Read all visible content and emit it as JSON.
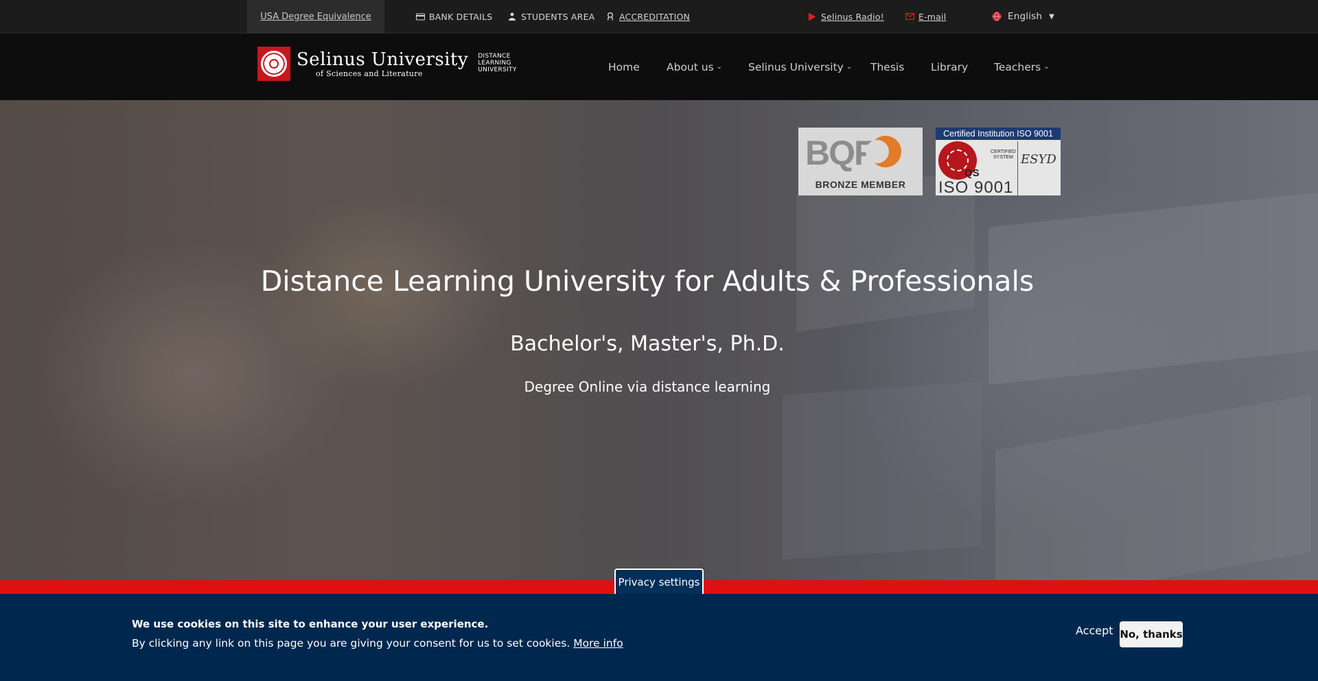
{
  "topbar": {
    "usa_degree": "USA Degree Equivalence",
    "bank_details": "BANK DETAILS",
    "students_area": "STUDENTS AREA",
    "accreditation": "ACCREDITATION",
    "radio": "Selinus Radio!",
    "email": "E-mail",
    "language": "English",
    "icons": {
      "bank": "bank-card-icon",
      "students": "student-icon",
      "accreditation": "award-icon",
      "radio": "play-icon",
      "email": "envelope-icon",
      "language": "globe-icon"
    }
  },
  "header": {
    "logo": {
      "name_line1": "Selinus University",
      "name_line2": "of Sciences and Literature",
      "sub": [
        "DISTANCE",
        "LEARNING",
        "UNIVERSITY"
      ]
    },
    "nav": [
      {
        "label": "Home"
      },
      {
        "label": "About us"
      },
      {
        "label": "Selinus University"
      },
      {
        "label": "Thesis"
      },
      {
        "label": "Library"
      },
      {
        "label": "Teachers"
      }
    ]
  },
  "hero": {
    "title": "Distance Learning University for Adults & Professionals",
    "subtitle": "Bachelor's, Master's, Ph.D.",
    "tagline": "Degree Online via distance learning",
    "badges": {
      "bqf": {
        "logo": "BQF",
        "caption": "BRONZE MEMBER"
      },
      "iso": {
        "header": "Certified Institution ISO 9001",
        "qs": "QS",
        "certified": [
          "CERTIFIED",
          "SYSTEM"
        ],
        "body": "ESYD",
        "standard": "ISO 9001"
      }
    }
  },
  "cookie": {
    "privacy_tab": "Privacy settings",
    "title": "We use cookies on this site to enhance your user experience.",
    "text": "By clicking any link on this page you are giving your consent for us to set cookies.",
    "more_info": "More info",
    "accept": "Accept",
    "no_thanks": "No, thanks"
  },
  "colors": {
    "topbar_bg": "#1c1c1c",
    "navbar_bg": "#0d0d0d",
    "accent_red": "#e01010",
    "cookie_bg": "#00284f"
  }
}
